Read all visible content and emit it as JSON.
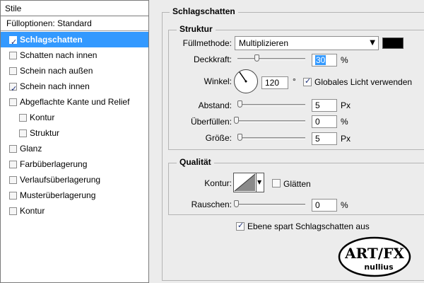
{
  "left_panel": {
    "header": "Stile",
    "fill_options": "Fülloptionen: Standard",
    "items": [
      {
        "label": "Schlagschatten",
        "checked": true,
        "selected": true
      },
      {
        "label": "Schatten nach innen",
        "checked": false
      },
      {
        "label": "Schein nach außen",
        "checked": false
      },
      {
        "label": "Schein nach innen",
        "checked": true
      },
      {
        "label": "Abgeflachte Kante und Relief",
        "checked": false
      },
      {
        "label": "Kontur",
        "checked": false,
        "indent": true
      },
      {
        "label": "Struktur",
        "checked": false,
        "indent": true
      },
      {
        "label": "Glanz",
        "checked": false
      },
      {
        "label": "Farbüberlagerung",
        "checked": false
      },
      {
        "label": "Verlaufsüberlagerung",
        "checked": false
      },
      {
        "label": "Musterüberlagerung",
        "checked": false
      },
      {
        "label": "Kontur",
        "checked": false
      }
    ]
  },
  "panel_title": "Schlagschatten",
  "structure": {
    "title": "Struktur",
    "blend_mode_label": "Füllmethode:",
    "blend_mode_value": "Multiplizieren",
    "shadow_color": "#000000",
    "opacity_label": "Deckkraft:",
    "opacity_value": "30",
    "opacity_unit": "%",
    "opacity_fraction": 0.3,
    "angle_label": "Winkel:",
    "angle_value": "120",
    "angle_unit": "°",
    "global_light_label": "Globales Licht verwenden",
    "global_light_checked": true,
    "distance_label": "Abstand:",
    "distance_value": "5",
    "distance_unit": "Px",
    "spread_label": "Überfüllen:",
    "spread_value": "0",
    "spread_unit": "%",
    "size_label": "Größe:",
    "size_value": "5",
    "size_unit": "Px"
  },
  "quality": {
    "title": "Qualität",
    "contour_label": "Kontur:",
    "antialias_label": "Glätten",
    "antialias_checked": false,
    "noise_label": "Rauschen:",
    "noise_value": "0",
    "noise_unit": "%"
  },
  "knockout_label": "Ebene spart Schlagschatten aus",
  "knockout_checked": true,
  "logo": {
    "line1": "ART/FX",
    "line2": "nullius"
  },
  "colors": {
    "selection": "#3399ff",
    "panel_bg": "#ececec"
  }
}
